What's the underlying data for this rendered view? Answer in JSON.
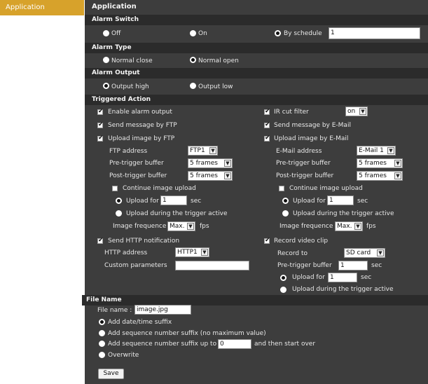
{
  "sidebar": {
    "items": [
      {
        "label": "Application"
      }
    ]
  },
  "page": {
    "title": "Application"
  },
  "alarm_switch": {
    "title": "Alarm Switch",
    "options": [
      {
        "label": "Off"
      },
      {
        "label": "On"
      },
      {
        "label": "By schedule"
      }
    ],
    "selected": "By schedule",
    "schedule_value": "1"
  },
  "alarm_type": {
    "title": "Alarm Type",
    "options": [
      {
        "label": "Normal close"
      },
      {
        "label": "Normal open"
      }
    ],
    "selected": "Normal open"
  },
  "alarm_output": {
    "title": "Alarm Output",
    "options": [
      {
        "label": "Output high"
      },
      {
        "label": "Output low"
      }
    ],
    "selected": "Output high"
  },
  "triggered": {
    "title": "Triggered Action",
    "enable_alarm_output": "Enable alarm output",
    "ir_cut_filter": "IR cut filter",
    "ir_cut_value": "on",
    "send_ftp": "Send message by FTP",
    "send_email": "Send message by E-Mail",
    "ftp": {
      "upload_label": "Upload image by FTP",
      "address_label": "FTP address",
      "address_value": "FTP1",
      "pre_label": "Pre-trigger buffer",
      "pre_value": "5 frames",
      "post_label": "Post-trigger buffer",
      "post_value": "5 frames",
      "continue_label": "Continue image upload",
      "upload_for_label": "Upload for",
      "upload_for_value": "1",
      "sec": "sec",
      "during_label": "Upload during the trigger active",
      "freq_label": "Image frequence",
      "freq_value": "Max.",
      "fps": "fps"
    },
    "email": {
      "upload_label": "Upload image by E-Mail",
      "address_label": "E-Mail address",
      "address_value": "E-Mail 1",
      "pre_label": "Pre-trigger buffer",
      "pre_value": "5 frames",
      "post_label": "Post-trigger buffer",
      "post_value": "5 frames",
      "continue_label": "Continue image upload",
      "upload_for_label": "Upload for",
      "upload_for_value": "1",
      "sec": "sec",
      "during_label": "Upload during the trigger active",
      "freq_label": "Image frequence",
      "freq_value": "Max.",
      "fps": "fps"
    },
    "http": {
      "label": "Send HTTP notification",
      "address_label": "HTTP address",
      "address_value": "HTTP1",
      "custom_label": "Custom parameters",
      "custom_value": ""
    },
    "video": {
      "label": "Record video clip",
      "record_to_label": "Record to",
      "record_to_value": "SD card",
      "pre_label": "Pre-trigger buffer",
      "pre_value": "1",
      "sec": "sec",
      "upload_for_label": "Upload for",
      "upload_for_value": "1",
      "during_label": "Upload during the trigger active"
    }
  },
  "file_name": {
    "title": "File Name",
    "name_label": "File name :",
    "name_value": "image.jpg",
    "options": [
      {
        "label": "Add date/time suffix"
      },
      {
        "label": "Add sequence number suffix (no maximum value)"
      },
      {
        "label": "Add sequence number suffix up to"
      },
      {
        "label": "Overwrite"
      }
    ],
    "selected": "Add date/time suffix",
    "up_to_value": "0",
    "then_label": "and then start over",
    "save_label": "Save"
  },
  "colors": {
    "accent": "#d7a22b",
    "panel": "#3d3d3d",
    "header": "#2b2b2b"
  }
}
